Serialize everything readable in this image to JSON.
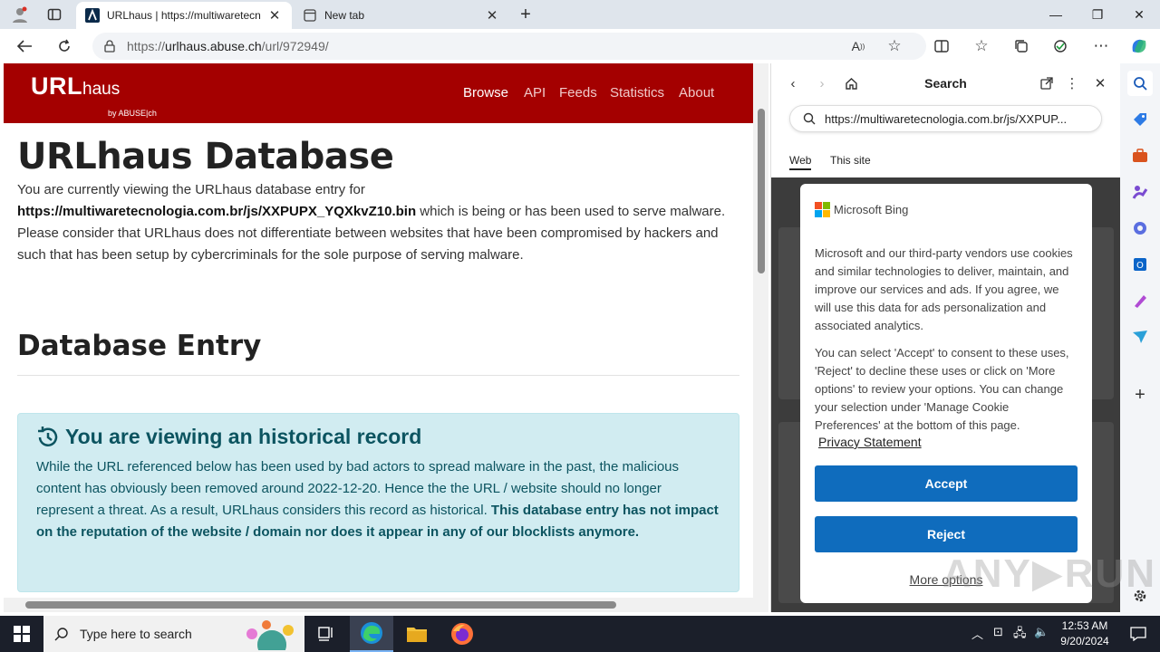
{
  "browser": {
    "tabs": [
      {
        "title": "URLhaus | https://multiwaretecn",
        "active": true
      },
      {
        "title": "New tab",
        "active": false
      }
    ],
    "address": {
      "prefix": "https://",
      "host": "urlhaus.abuse.ch",
      "path": "/url/972949/"
    }
  },
  "urlhaus": {
    "logo_main": "URL",
    "logo_small": "haus",
    "logo_sub": "by ABUSE|ch",
    "nav": [
      "Browse",
      "API",
      "Feeds",
      "Statistics",
      "About"
    ],
    "title": "URLhaus Database",
    "intro_before": "You are currently viewing the URLhaus database entry for",
    "intro_url": "https://multiwaretecnologia.com.br/js/XXPUPX_YQXkvZ10.bin",
    "intro_after": " which is being or has been used to serve malware. Please consider that URLhaus does not differentiate between websites that have been compromised by hackers and such that has been setup by cybercriminals for the sole purpose of serving malware.",
    "section_title": "Database Entry",
    "alert_title": "You are viewing an historical record",
    "alert_text": "While the URL referenced below has been used by bad actors to spread malware in the past, the malicious content has obviously been removed around 2022-12-20. Hence the the URL / website should no longer represent a threat. As a result, URLhaus considers this record as historical. ",
    "alert_bold": "This database entry has not impact on the reputation of the website / domain nor does it appear in any of our blocklists anymore."
  },
  "sidepanel": {
    "title": "Search",
    "query": "https://multiwaretecnologia.com.br/js/XXPUP...",
    "tabs": [
      "Web",
      "This site"
    ],
    "consent": {
      "brand": "Microsoft Bing",
      "text1": "Microsoft and our third-party vendors use cookies and similar technologies to deliver, maintain, and improve our services and ads. If you agree, we will use this data for ads personalization and associated analytics.",
      "text2": "You can select 'Accept' to consent to these uses, 'Reject' to decline these uses or click on 'More options' to review your options. You can change your selection under 'Manage Cookie Preferences' at the bottom of this page.",
      "privacy": "Privacy Statement",
      "accept": "Accept",
      "reject": "Reject",
      "more": "More options"
    }
  },
  "taskbar": {
    "search_placeholder": "Type here to search",
    "time": "12:53 AM",
    "date": "9/20/2024"
  },
  "colors": {
    "urlhaus_red": "#a40000",
    "alert_bg": "#d1ecf1",
    "bing_blue": "#0f6cbd"
  }
}
